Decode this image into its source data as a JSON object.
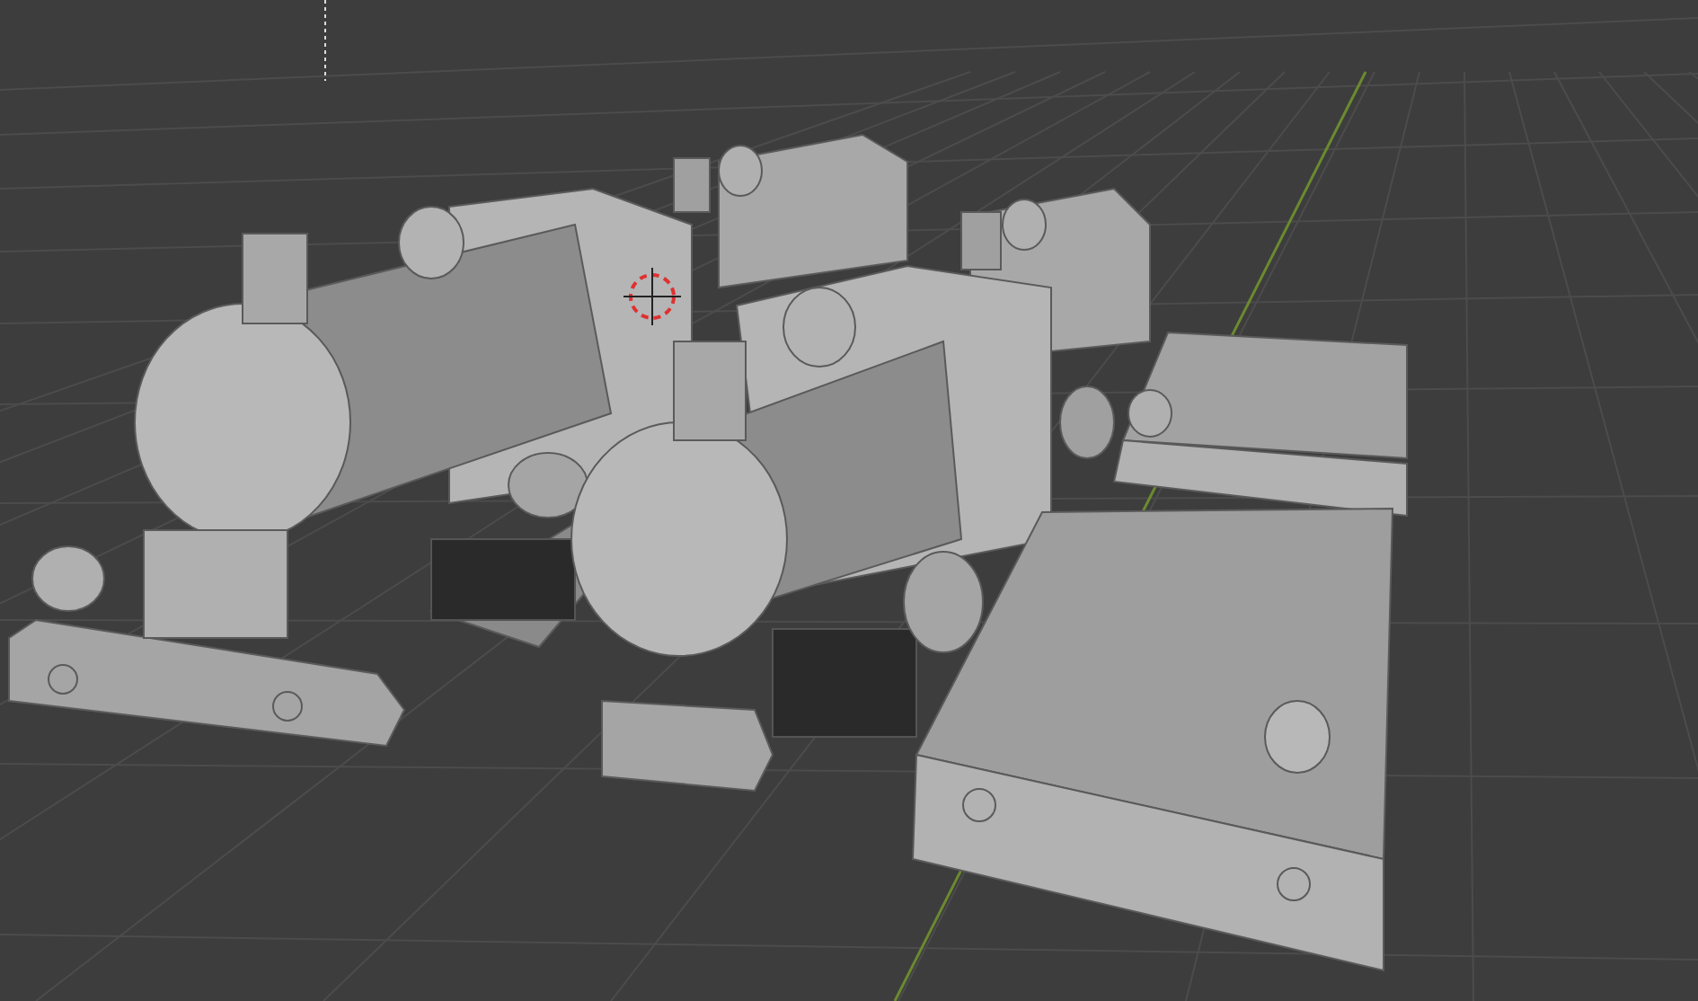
{
  "viewport": {
    "show_grid": true,
    "show_3d_cursor": true
  }
}
